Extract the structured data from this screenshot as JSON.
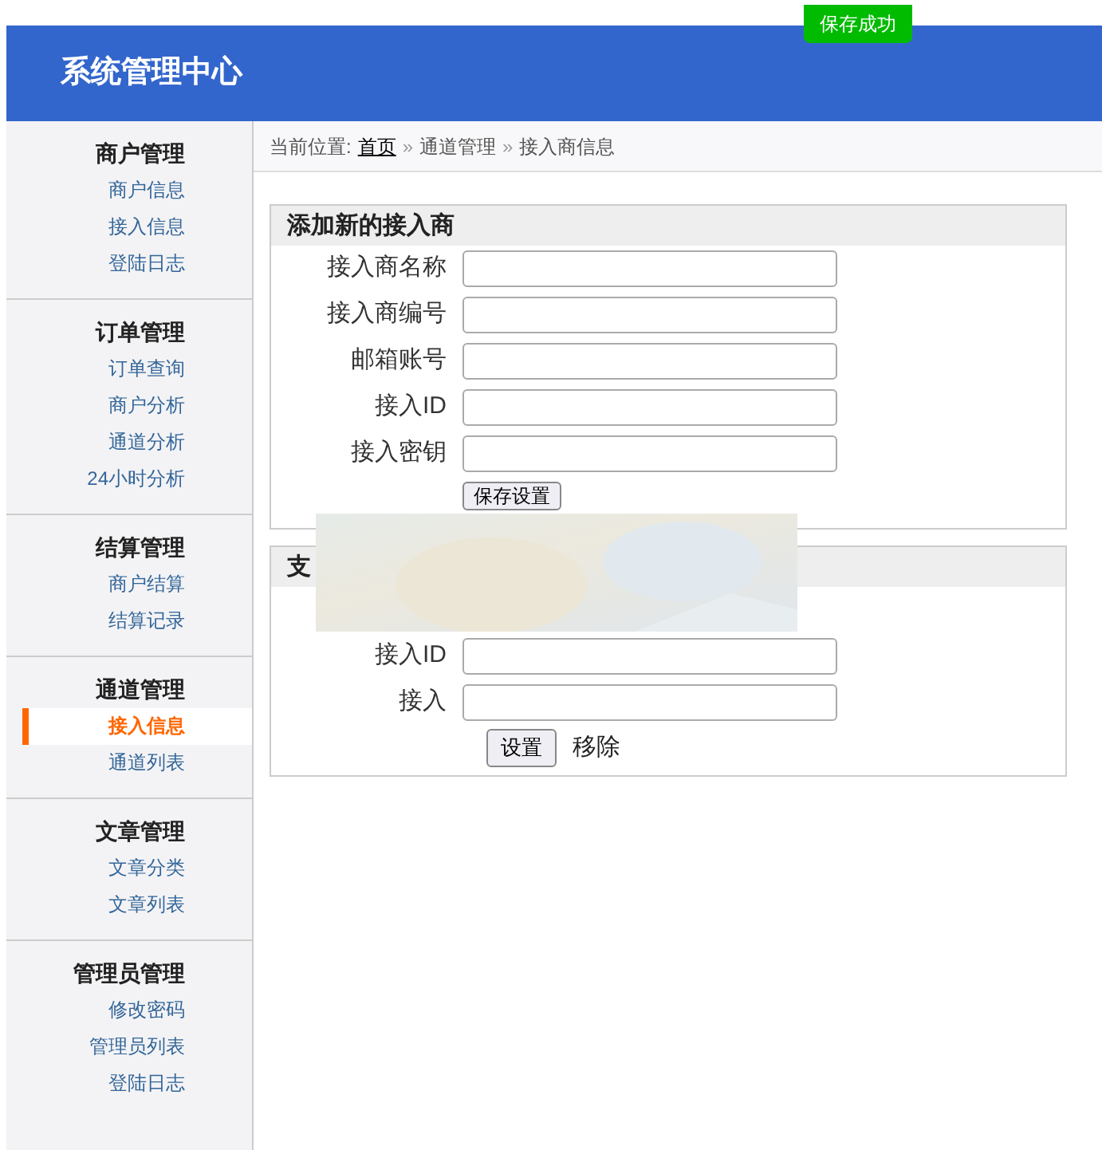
{
  "toast": "保存成功",
  "header": {
    "title": "系统管理中心"
  },
  "sidebar": [
    {
      "title": "商户管理",
      "items": [
        {
          "label": "商户信息",
          "selected": false
        },
        {
          "label": "接入信息",
          "selected": false
        },
        {
          "label": "登陆日志",
          "selected": false
        }
      ]
    },
    {
      "title": "订单管理",
      "items": [
        {
          "label": "订单查询",
          "selected": false
        },
        {
          "label": "商户分析",
          "selected": false
        },
        {
          "label": "通道分析",
          "selected": false
        },
        {
          "label": "24小时分析",
          "selected": false
        }
      ]
    },
    {
      "title": "结算管理",
      "items": [
        {
          "label": "商户结算",
          "selected": false
        },
        {
          "label": "结算记录",
          "selected": false
        }
      ]
    },
    {
      "title": "通道管理",
      "items": [
        {
          "label": "接入信息",
          "selected": true
        },
        {
          "label": "通道列表",
          "selected": false
        }
      ]
    },
    {
      "title": "文章管理",
      "items": [
        {
          "label": "文章分类",
          "selected": false
        },
        {
          "label": "文章列表",
          "selected": false
        }
      ]
    },
    {
      "title": "管理员管理",
      "items": [
        {
          "label": "修改密码",
          "selected": false
        },
        {
          "label": "管理员列表",
          "selected": false
        },
        {
          "label": "登陆日志",
          "selected": false
        }
      ]
    }
  ],
  "breadcrumb": {
    "prefix": "当前位置:",
    "home": "首页",
    "sep1": "»",
    "section": "通道管理",
    "sep2": "»",
    "page": "接入商信息"
  },
  "add_panel": {
    "title": "添加新的接入商",
    "fields": [
      {
        "label": "接入商名称"
      },
      {
        "label": "接入商编号"
      },
      {
        "label": "邮箱账号"
      },
      {
        "label": "接入ID"
      },
      {
        "label": "接入密钥"
      }
    ],
    "button": "保存设置"
  },
  "second_panel": {
    "title": "支",
    "fields": [
      {
        "label": "接入ID"
      },
      {
        "label": "接入"
      }
    ],
    "button": "设置",
    "remove": "移除"
  }
}
